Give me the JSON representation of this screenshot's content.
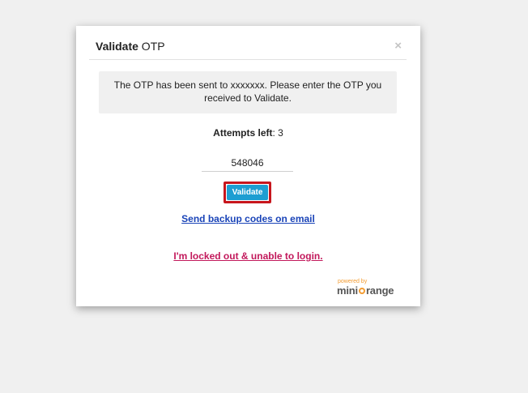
{
  "modal": {
    "title_strong": "Validate",
    "title_rest": " OTP",
    "close": "×",
    "message": "The OTP has been sent to xxxxxxx. Please enter the OTP you received to Validate.",
    "attempts_label": "Attempts left",
    "attempts_value": ": 3",
    "otp_value": "548046",
    "validate_label": "Validate",
    "backup_link": "Send backup codes on email",
    "locked_link": "I'm locked out & unable to login."
  },
  "branding": {
    "powered_by": "powered by",
    "brand_prefix": "mini",
    "brand_suffix": "range",
    "accent_color": "#f39c32"
  },
  "colors": {
    "validate_button": "#1d9ed2",
    "validate_highlight": "#c7161d",
    "backup_link": "#1a44b8",
    "locked_link": "#c2185b"
  }
}
